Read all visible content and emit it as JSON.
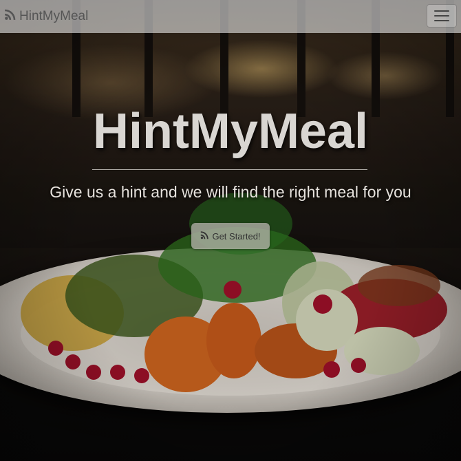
{
  "navbar": {
    "brand_label": "HintMyMeal",
    "brand_icon": "rss-feed-icon",
    "menu_icon": "hamburger-menu-icon"
  },
  "hero": {
    "title": "HintMyMeal",
    "subtitle": "Give us a hint and we will find the right meal for you",
    "cta_label": "Get Started!",
    "cta_icon": "rss-feed-icon"
  },
  "colors": {
    "navbar_bg": "#ffffffcc",
    "title_text": "#d9d6d2",
    "cta_bg": "#beb9b4"
  }
}
